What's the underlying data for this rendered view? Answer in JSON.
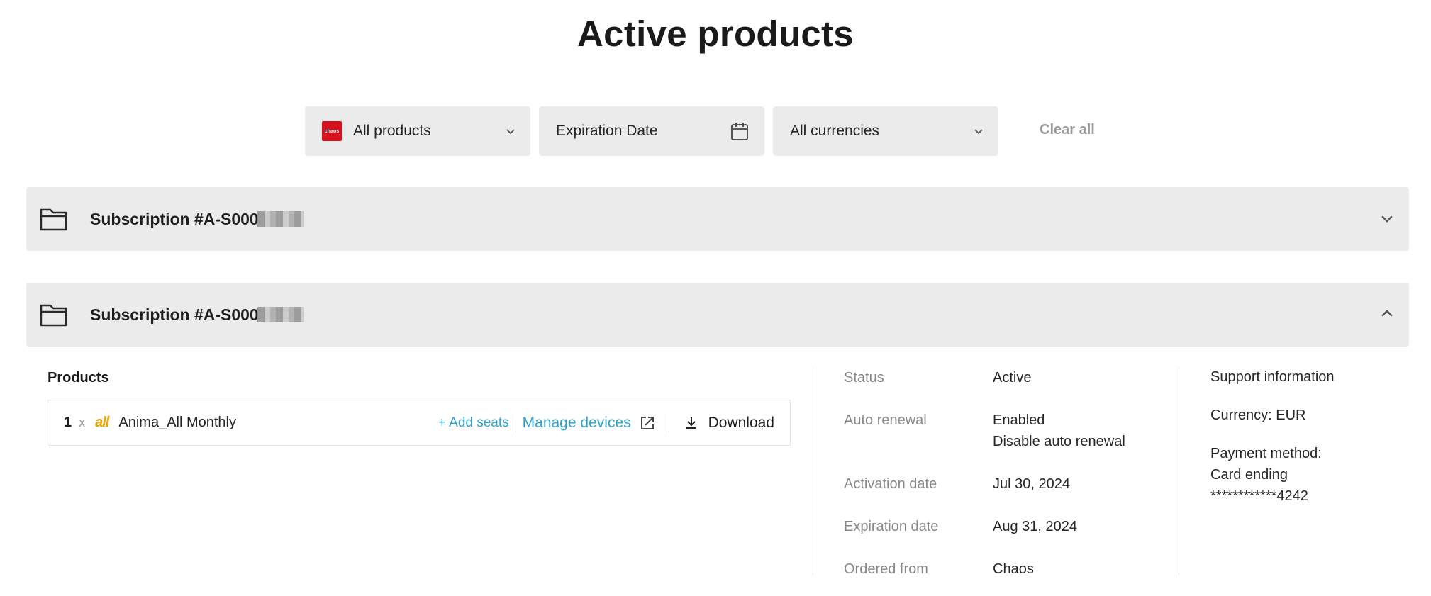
{
  "page": {
    "title": "Active products"
  },
  "filters": {
    "products": {
      "brand_logo_text": "chaos",
      "label": "All products"
    },
    "expiration": {
      "label": "Expiration Date"
    },
    "currencies": {
      "label": "All currencies"
    },
    "clear_all": "Clear all"
  },
  "subscriptions": [
    {
      "title": "Subscription #A-S000",
      "expanded": false,
      "icon": "folder-icon",
      "toggle_icon": "chevron-down-icon"
    },
    {
      "title": "Subscription #A-S000",
      "expanded": true,
      "icon": "folder-icon",
      "toggle_icon": "chevron-up-icon"
    }
  ],
  "detail": {
    "products_heading": "Products",
    "product": {
      "quantity": "1",
      "times": "x",
      "logo_text": "all",
      "name": "Anima_All Monthly",
      "add_seats": "+ Add seats",
      "manage_devices": "Manage devices",
      "download": "Download"
    },
    "info": {
      "status_label": "Status",
      "status_value": "Active",
      "auto_renewal_label": "Auto renewal",
      "auto_renewal_value": "Enabled",
      "disable_auto_renewal": "Disable auto renewal",
      "activation_label": "Activation date",
      "activation_value": "Jul 30, 2024",
      "expiration_label": "Expiration date",
      "expiration_value": "Aug 31, 2024",
      "ordered_from_label": "Ordered from",
      "ordered_from_value": "Chaos"
    },
    "side": {
      "support_information": "Support information",
      "currency": "Currency: EUR",
      "payment_method_label": "Payment method:",
      "card_ending": "Card ending",
      "card_number": "************4242"
    }
  },
  "colors": {
    "accent_link": "#2fa3cf",
    "brand_red": "#d5121e",
    "anima_yellow": "#f0a400",
    "panel_bg": "#ebebeb"
  }
}
